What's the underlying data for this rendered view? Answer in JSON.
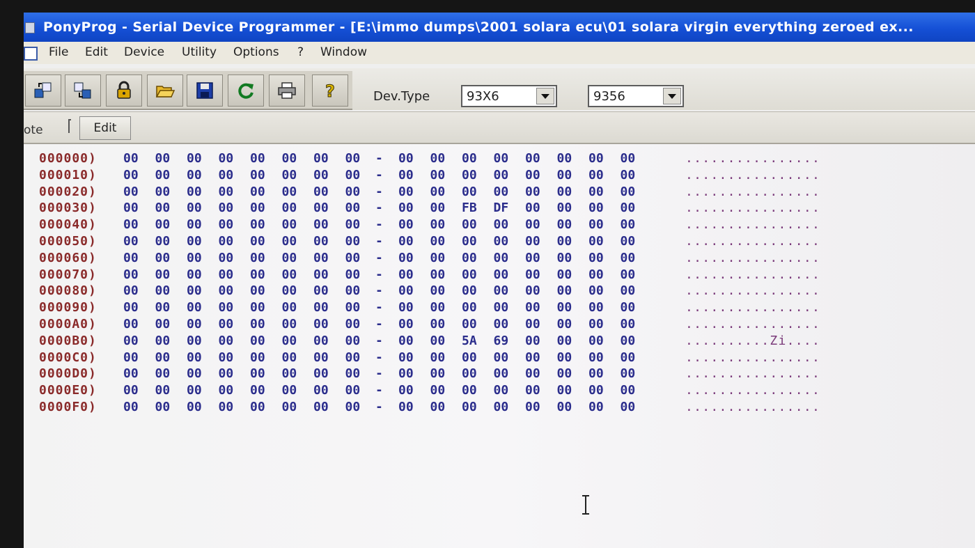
{
  "window": {
    "title": "PonyProg - Serial Device Programmer - [E:\\immo dumps\\2001 solara ecu\\01 solara  virgin everything zeroed ex..."
  },
  "menu": [
    {
      "label": "File"
    },
    {
      "label": "Edit"
    },
    {
      "label": "Device"
    },
    {
      "label": "Utility"
    },
    {
      "label": "Options"
    },
    {
      "label": "?"
    },
    {
      "label": "Window"
    }
  ],
  "toolbar": {
    "buttons": [
      {
        "icon": "open-device-icon"
      },
      {
        "icon": "save-device-icon"
      },
      {
        "icon": "lock-icon"
      },
      {
        "icon": "open-folder-icon"
      },
      {
        "icon": "floppy-save-icon"
      },
      {
        "icon": "reload-icon"
      },
      {
        "icon": "print-icon"
      },
      {
        "icon": "help-icon"
      }
    ],
    "devtype_label": "Dev.Type",
    "devtype_family": "93X6",
    "devtype_model": "9356"
  },
  "notebar": {
    "note_label": "ote",
    "edit_label": "Edit"
  },
  "hex": {
    "separator": "-",
    "rows": [
      {
        "addr": "000000)",
        "bytes": [
          "00",
          "00",
          "00",
          "00",
          "00",
          "00",
          "00",
          "00",
          "00",
          "00",
          "00",
          "00",
          "00",
          "00",
          "00",
          "00"
        ],
        "ascii": "................"
      },
      {
        "addr": "000010)",
        "bytes": [
          "00",
          "00",
          "00",
          "00",
          "00",
          "00",
          "00",
          "00",
          "00",
          "00",
          "00",
          "00",
          "00",
          "00",
          "00",
          "00"
        ],
        "ascii": "................"
      },
      {
        "addr": "000020)",
        "bytes": [
          "00",
          "00",
          "00",
          "00",
          "00",
          "00",
          "00",
          "00",
          "00",
          "00",
          "00",
          "00",
          "00",
          "00",
          "00",
          "00"
        ],
        "ascii": "................"
      },
      {
        "addr": "000030)",
        "bytes": [
          "00",
          "00",
          "00",
          "00",
          "00",
          "00",
          "00",
          "00",
          "00",
          "00",
          "FB",
          "DF",
          "00",
          "00",
          "00",
          "00"
        ],
        "ascii": "................"
      },
      {
        "addr": "000040)",
        "bytes": [
          "00",
          "00",
          "00",
          "00",
          "00",
          "00",
          "00",
          "00",
          "00",
          "00",
          "00",
          "00",
          "00",
          "00",
          "00",
          "00"
        ],
        "ascii": "................"
      },
      {
        "addr": "000050)",
        "bytes": [
          "00",
          "00",
          "00",
          "00",
          "00",
          "00",
          "00",
          "00",
          "00",
          "00",
          "00",
          "00",
          "00",
          "00",
          "00",
          "00"
        ],
        "ascii": "................"
      },
      {
        "addr": "000060)",
        "bytes": [
          "00",
          "00",
          "00",
          "00",
          "00",
          "00",
          "00",
          "00",
          "00",
          "00",
          "00",
          "00",
          "00",
          "00",
          "00",
          "00"
        ],
        "ascii": "................"
      },
      {
        "addr": "000070)",
        "bytes": [
          "00",
          "00",
          "00",
          "00",
          "00",
          "00",
          "00",
          "00",
          "00",
          "00",
          "00",
          "00",
          "00",
          "00",
          "00",
          "00"
        ],
        "ascii": "................"
      },
      {
        "addr": "000080)",
        "bytes": [
          "00",
          "00",
          "00",
          "00",
          "00",
          "00",
          "00",
          "00",
          "00",
          "00",
          "00",
          "00",
          "00",
          "00",
          "00",
          "00"
        ],
        "ascii": "................"
      },
      {
        "addr": "000090)",
        "bytes": [
          "00",
          "00",
          "00",
          "00",
          "00",
          "00",
          "00",
          "00",
          "00",
          "00",
          "00",
          "00",
          "00",
          "00",
          "00",
          "00"
        ],
        "ascii": "................"
      },
      {
        "addr": "0000A0)",
        "bytes": [
          "00",
          "00",
          "00",
          "00",
          "00",
          "00",
          "00",
          "00",
          "00",
          "00",
          "00",
          "00",
          "00",
          "00",
          "00",
          "00"
        ],
        "ascii": "................"
      },
      {
        "addr": "0000B0)",
        "bytes": [
          "00",
          "00",
          "00",
          "00",
          "00",
          "00",
          "00",
          "00",
          "00",
          "00",
          "5A",
          "69",
          "00",
          "00",
          "00",
          "00"
        ],
        "ascii": "..........Zi...."
      },
      {
        "addr": "0000C0)",
        "bytes": [
          "00",
          "00",
          "00",
          "00",
          "00",
          "00",
          "00",
          "00",
          "00",
          "00",
          "00",
          "00",
          "00",
          "00",
          "00",
          "00"
        ],
        "ascii": "................"
      },
      {
        "addr": "0000D0)",
        "bytes": [
          "00",
          "00",
          "00",
          "00",
          "00",
          "00",
          "00",
          "00",
          "00",
          "00",
          "00",
          "00",
          "00",
          "00",
          "00",
          "00"
        ],
        "ascii": "................"
      },
      {
        "addr": "0000E0)",
        "bytes": [
          "00",
          "00",
          "00",
          "00",
          "00",
          "00",
          "00",
          "00",
          "00",
          "00",
          "00",
          "00",
          "00",
          "00",
          "00",
          "00"
        ],
        "ascii": "................"
      },
      {
        "addr": "0000F0)",
        "bytes": [
          "00",
          "00",
          "00",
          "00",
          "00",
          "00",
          "00",
          "00",
          "00",
          "00",
          "00",
          "00",
          "00",
          "00",
          "00",
          "00"
        ],
        "ascii": "................"
      }
    ]
  },
  "colors": {
    "title_bar": "#1550d6",
    "address_text": "#8a2a2a",
    "byte_text": "#2b2d8c",
    "ascii_text": "#7a3a7a"
  }
}
